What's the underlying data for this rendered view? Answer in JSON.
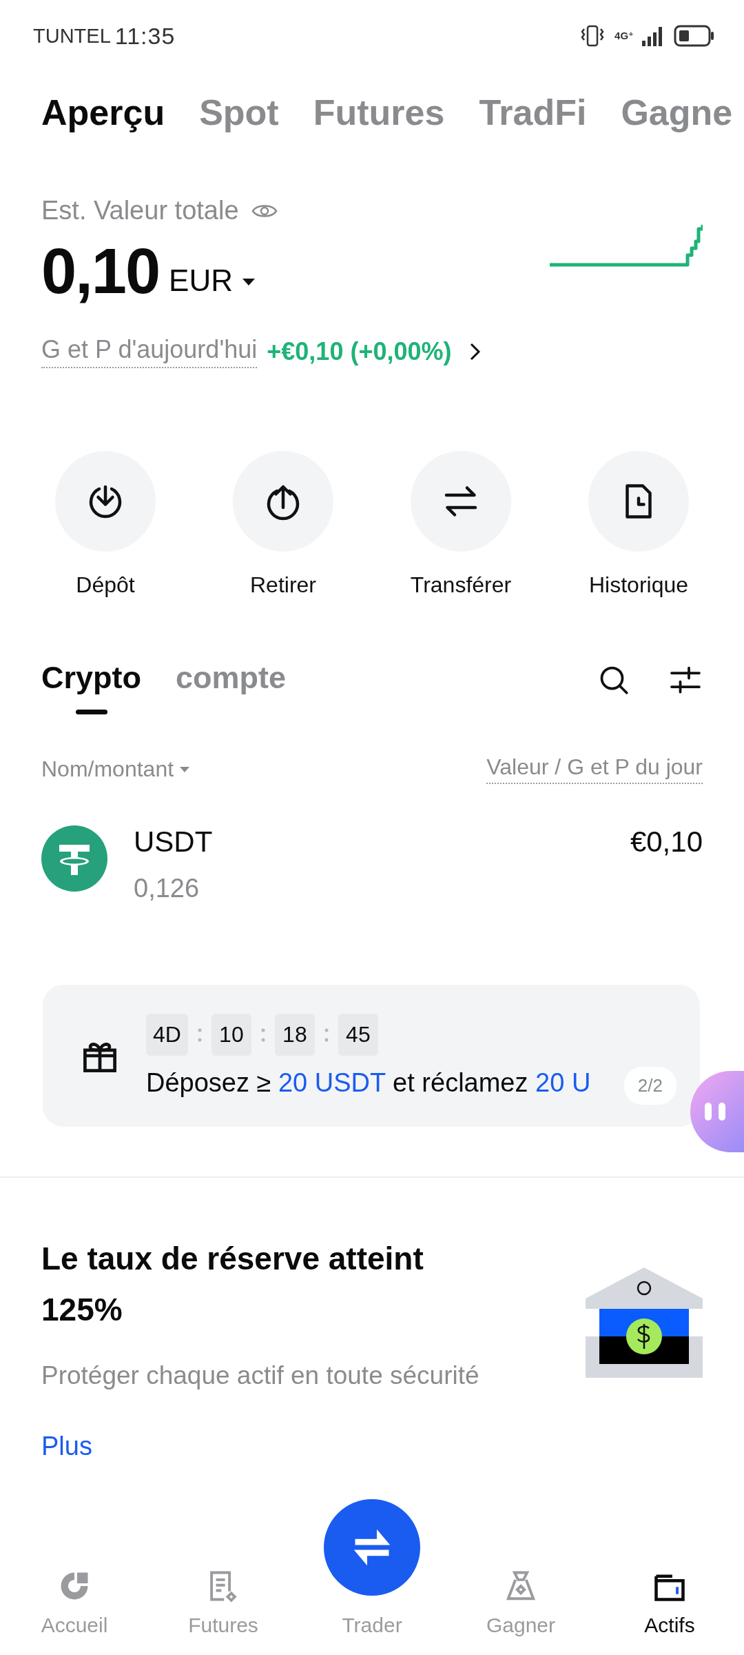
{
  "status_bar": {
    "carrier": "TUNTEL",
    "time": "11:35",
    "network": "4G⁺"
  },
  "top_tabs": [
    {
      "label": "Aperçu",
      "selected": true
    },
    {
      "label": "Spot",
      "selected": false
    },
    {
      "label": "Futures",
      "selected": false
    },
    {
      "label": "TradFi",
      "selected": false
    },
    {
      "label": "Gagne",
      "selected": false
    }
  ],
  "balance": {
    "label": "Est. Valeur totale",
    "amount": "0,10",
    "currency": "EUR",
    "pnl_label": "G et P d'aujourd'hui",
    "pnl_value": "+€0,10 (+0,00%)"
  },
  "actions": [
    {
      "label": "Dépôt"
    },
    {
      "label": "Retirer"
    },
    {
      "label": "Transférer"
    },
    {
      "label": "Historique"
    }
  ],
  "asset_tabs": [
    {
      "label": "Crypto",
      "selected": true
    },
    {
      "label": "compte",
      "selected": false
    }
  ],
  "list_header": {
    "left": "Nom/montant",
    "right": "Valeur / G et P du jour"
  },
  "assets": [
    {
      "symbol": "USDT",
      "amount": "0,126",
      "value": "€0,10"
    }
  ],
  "promo": {
    "countdown": [
      "4D",
      "10",
      "18",
      "45"
    ],
    "message": [
      {
        "text": "Déposez ≥ ",
        "highlight": false
      },
      {
        "text": "20 USDT",
        "highlight": true
      },
      {
        "text": " et réclamez ",
        "highlight": false
      },
      {
        "text": "20 U",
        "highlight": true
      }
    ],
    "pager": "2/2"
  },
  "reserve": {
    "title": "Le taux de réserve atteint 125%",
    "subtitle": "Protéger chaque actif en toute sécurité",
    "link": "Plus"
  },
  "bottom_nav": [
    {
      "label": "Accueil",
      "selected": false,
      "kind": "tab"
    },
    {
      "label": "Futures",
      "selected": false,
      "kind": "tab"
    },
    {
      "label": "Trader",
      "selected": false,
      "kind": "center"
    },
    {
      "label": "Gagner",
      "selected": false,
      "kind": "tab"
    },
    {
      "label": "Actifs",
      "selected": true,
      "kind": "tab"
    }
  ]
}
